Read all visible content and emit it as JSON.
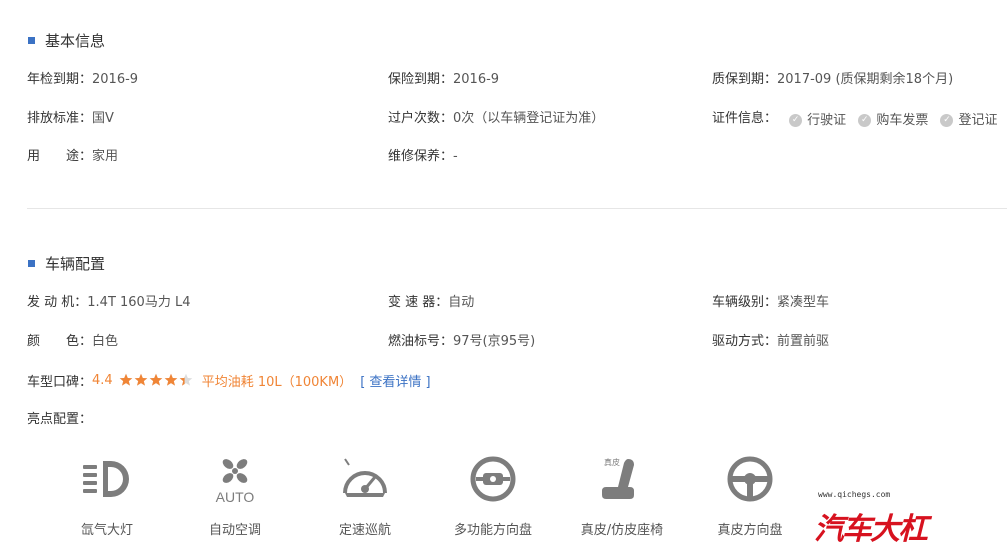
{
  "basic_info": {
    "title": "基本信息",
    "rows": [
      [
        {
          "label": "年检到期：",
          "value": "2016-9"
        },
        {
          "label": "保险到期：",
          "value": "2016-9"
        },
        {
          "label": "质保到期：",
          "value": "2017-09 (质保期剩余18个月)"
        }
      ],
      [
        {
          "label": "排放标准：",
          "value": "国V"
        },
        {
          "label": "过户次数：",
          "value": "0次（以车辆登记证为准）"
        },
        {
          "label": "证件信息：",
          "value": ""
        }
      ],
      [
        {
          "label": "用　　途：",
          "value": "家用"
        },
        {
          "label": "维修保养：",
          "value": "-"
        },
        {
          "label": "",
          "value": ""
        }
      ]
    ],
    "certificates": [
      "行驶证",
      "购车发票",
      "登记证"
    ]
  },
  "vehicle_config": {
    "title": "车辆配置",
    "rows": [
      [
        {
          "label": "发 动 机：",
          "value": "1.4T 160马力 L4"
        },
        {
          "label": "变 速 器：",
          "value": "自动"
        },
        {
          "label": "车辆级别：",
          "value": "紧凑型车"
        }
      ],
      [
        {
          "label": "颜　　色：",
          "value": "白色"
        },
        {
          "label": "燃油标号：",
          "value": "97号(京95号)"
        },
        {
          "label": "驱动方式：",
          "value": "前置前驱"
        }
      ]
    ],
    "rating": {
      "label": "车型口碑：",
      "score": "4.4",
      "stars_value": 4.4,
      "stars_max": 5,
      "fuel": "平均油耗 10L（100KM）",
      "link": "[ 查看详情 ]"
    },
    "highlight_label": "亮点配置：",
    "features": [
      {
        "name": "氙气大灯",
        "icon": "xenon-headlight-icon"
      },
      {
        "name": "自动空调",
        "icon": "auto-ac-icon",
        "icon_text": "AUTO"
      },
      {
        "name": "定速巡航",
        "icon": "cruise-control-icon"
      },
      {
        "name": "多功能方向盘",
        "icon": "multifunction-wheel-icon"
      },
      {
        "name": "真皮/仿皮座椅",
        "icon": "leather-seat-icon",
        "icon_text": "真皮"
      },
      {
        "name": "真皮方向盘",
        "icon": "leather-wheel-icon"
      }
    ]
  },
  "watermark": {
    "url": "www.qichegs.com",
    "text": "汽车大杠"
  },
  "colors": {
    "accent_blue": "#3b72c4",
    "rating_orange": "#f08536",
    "icon_gray": "#7d7d7d",
    "watermark_red": "#d7121f"
  }
}
